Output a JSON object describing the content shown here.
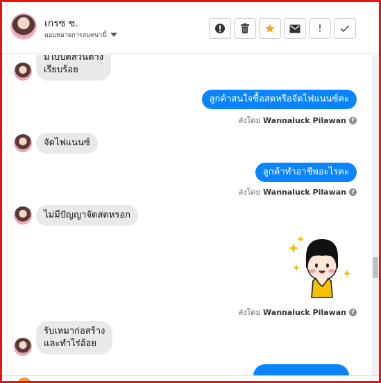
{
  "header": {
    "name": "เกรซ ซ.",
    "assign_label": "มอบหมายการสนทนานี้"
  },
  "toolbar": {
    "buttons": [
      "spam-icon",
      "trash-icon",
      "star-icon",
      "envelope-icon",
      "exclamation-icon",
      "check-icon"
    ],
    "bang_label": "!"
  },
  "colors": {
    "accent": "#0b84ff",
    "star": "#f5a623",
    "frame": "#ee1111",
    "incoming_bubble": "#e9e9eb"
  },
  "thread": {
    "messages": [
      {
        "dir": "in",
        "lines": [
          "มีใบปิดส่วนต่าง",
          "เรียบร้อย"
        ]
      },
      {
        "dir": "out",
        "text": "ลูกค้าสนใจซื้อสดหรือจัดไฟแนนซ์คะ"
      },
      {
        "dir": "in",
        "text": "จัดไฟแนนซ์"
      },
      {
        "dir": "out",
        "text": "ลูกค้าทำอาชีพอะไรคะ"
      },
      {
        "dir": "in",
        "text": "ไม่มีปัญญาจัดสดหรอก"
      },
      {
        "dir": "out",
        "sticker": "girl-cheer-sticker"
      },
      {
        "dir": "in",
        "lines": [
          "รับเหมาก่อสร้าง",
          "และทำไร่อ้อย"
        ]
      }
    ],
    "sent_by_prefix": "ส่งโดย",
    "sent_by_name": "Wannaluck Pilawan",
    "info_glyph": "?"
  }
}
